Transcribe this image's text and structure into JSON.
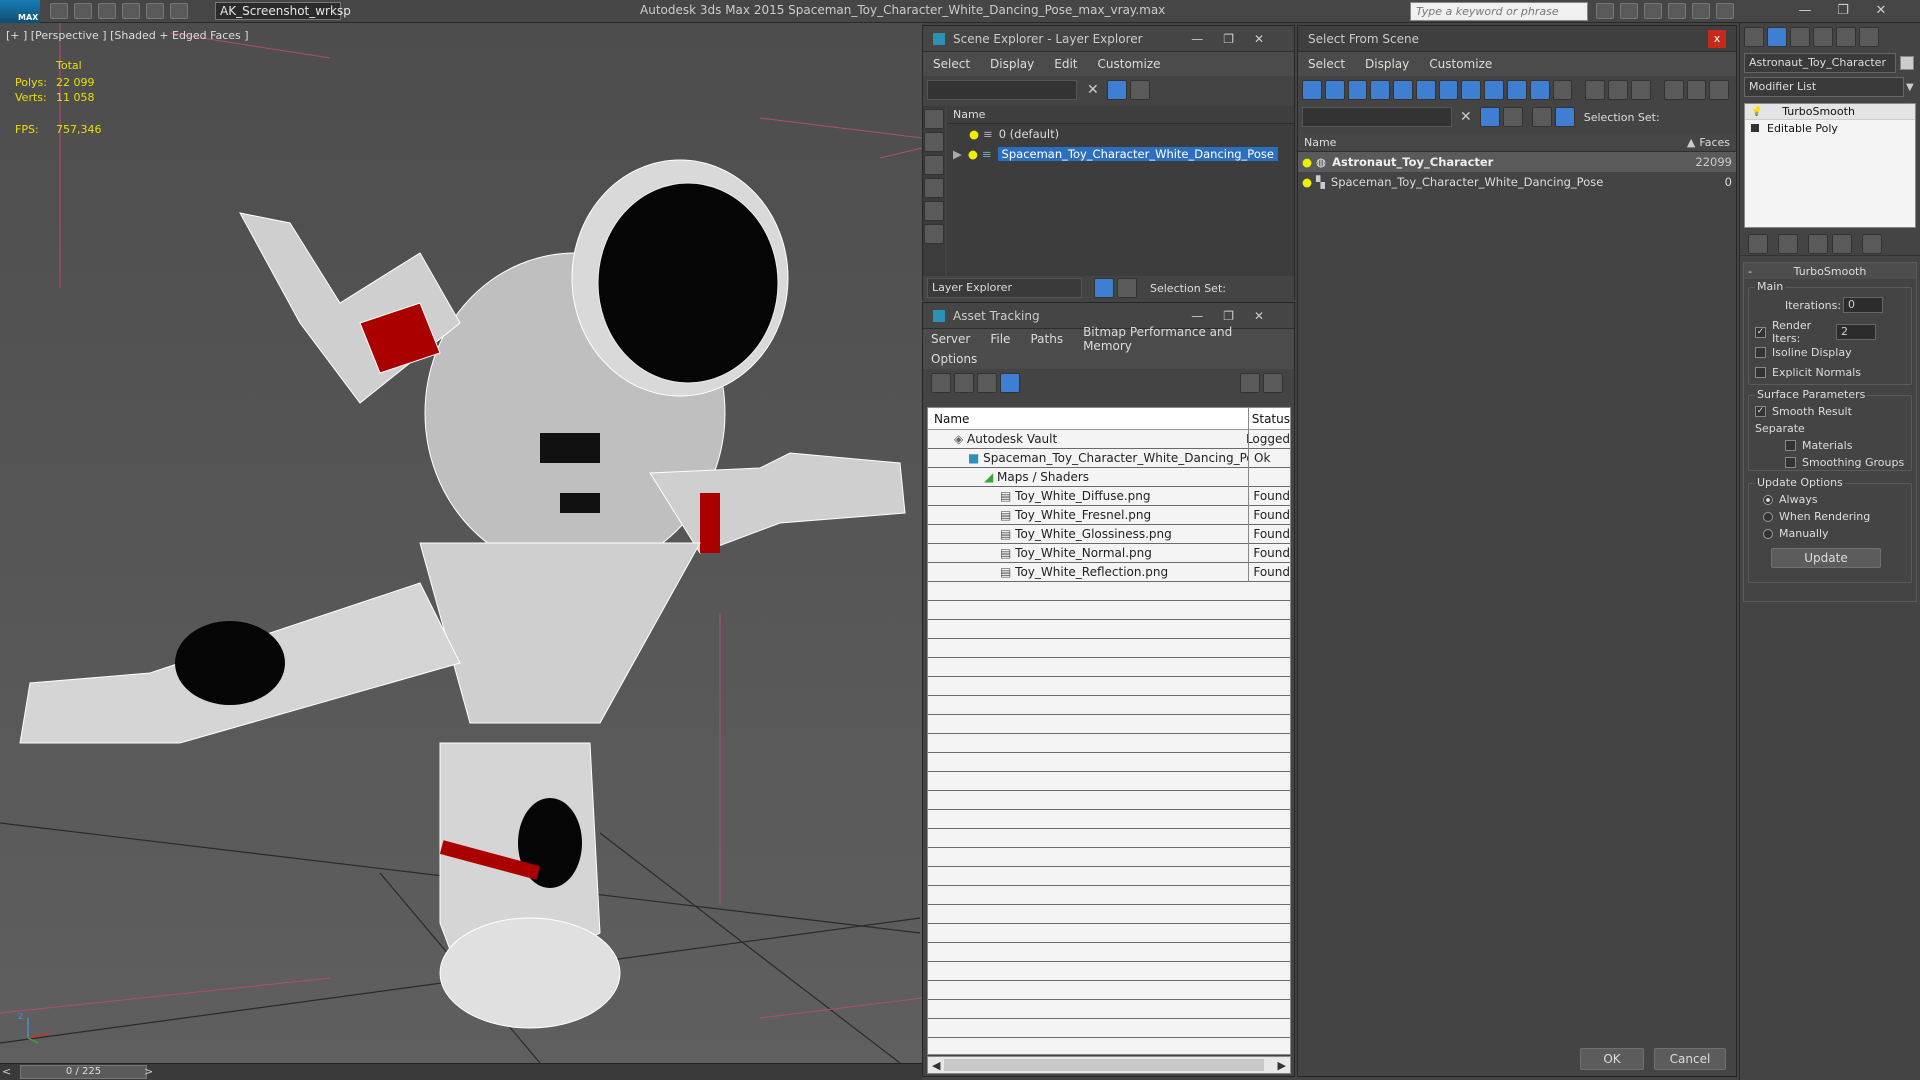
{
  "app": {
    "logo": "MAX",
    "workspace": "AK_Screenshot_wrksp",
    "title": "Autodesk 3ds Max  2015     Spaceman_Toy_Character_White_Dancing_Pose_max_vray.max",
    "search_placeholder": "Type a keyword or phrase"
  },
  "viewport": {
    "label": "[+ ] [Perspective ] [Shaded + Edged Faces ]",
    "stats": {
      "total_label": "Total",
      "polys_label": "Polys:",
      "polys": "22 099",
      "verts_label": "Verts:",
      "verts": "11 058",
      "fps_label": "FPS:",
      "fps": "757,346"
    },
    "axis_z": "z",
    "timeline": "0 / 225",
    "prev": "<",
    "next": ">"
  },
  "scene_explorer": {
    "title": "Scene Explorer - Layer Explorer",
    "menu": [
      "Select",
      "Display",
      "Edit",
      "Customize"
    ],
    "col_name": "Name",
    "rows": [
      {
        "label": "0 (default)",
        "selected": false
      },
      {
        "label": "Spaceman_Toy_Character_White_Dancing_Pose",
        "selected": true
      }
    ],
    "footer_dropdown": "Layer Explorer",
    "selection_set_label": "Selection Set:"
  },
  "asset_tracking": {
    "title": "Asset Tracking",
    "menu": [
      "Server",
      "File",
      "Paths",
      "Bitmap Performance and Memory"
    ],
    "menu2": [
      "Options"
    ],
    "col_name": "Name",
    "col_status": "Status",
    "rows": [
      {
        "name": "Autodesk Vault",
        "status": "Logged",
        "indent": 0
      },
      {
        "name": "Spaceman_Toy_Character_White_Dancing_Pose_...",
        "status": "Ok",
        "indent": 1
      },
      {
        "name": "Maps / Shaders",
        "status": "",
        "indent": 2
      },
      {
        "name": "Toy_White_Diffuse.png",
        "status": "Found",
        "indent": 3
      },
      {
        "name": "Toy_White_Fresnel.png",
        "status": "Found",
        "indent": 3
      },
      {
        "name": "Toy_White_Glossiness.png",
        "status": "Found",
        "indent": 3
      },
      {
        "name": "Toy_White_Normal.png",
        "status": "Found",
        "indent": 3
      },
      {
        "name": "Toy_White_Reflection.png",
        "status": "Found",
        "indent": 3
      }
    ]
  },
  "select_from_scene": {
    "title": "Select From Scene",
    "close": "x",
    "menu": [
      "Select",
      "Display",
      "Customize"
    ],
    "selection_set_label": "Selection Set:",
    "col_name": "Name",
    "col_faces": "Faces",
    "rows": [
      {
        "name": "Astronaut_Toy_Character",
        "faces": "22099",
        "selected": true
      },
      {
        "name": "Spaceman_Toy_Character_White_Dancing_Pose",
        "faces": "0",
        "selected": false
      }
    ],
    "ok": "OK",
    "cancel": "Cancel"
  },
  "modifier_panel": {
    "object_name": "Astronaut_Toy_Character",
    "modifier_list": "Modifier List",
    "stack": [
      "TurboSmooth",
      "Editable Poly"
    ],
    "rollout_title": "TurboSmooth",
    "rollout_toggle": "-",
    "main_label": "Main",
    "iterations_label": "Iterations:",
    "iterations": "0",
    "render_iters_label": "Render Iters:",
    "render_iters": "2",
    "isoline": "Isoline Display",
    "explicit": "Explicit Normals",
    "surface_label": "Surface Parameters",
    "smooth_result": "Smooth Result",
    "separate": "Separate",
    "materials": "Materials",
    "smoothing_groups": "Smoothing Groups",
    "update_options": "Update Options",
    "always": "Always",
    "when_rendering": "When Rendering",
    "manually": "Manually",
    "update_btn": "Update"
  },
  "colors": {
    "accent": "#2d6fbf",
    "viewport_bg": "#555555",
    "panel": "#444444"
  }
}
